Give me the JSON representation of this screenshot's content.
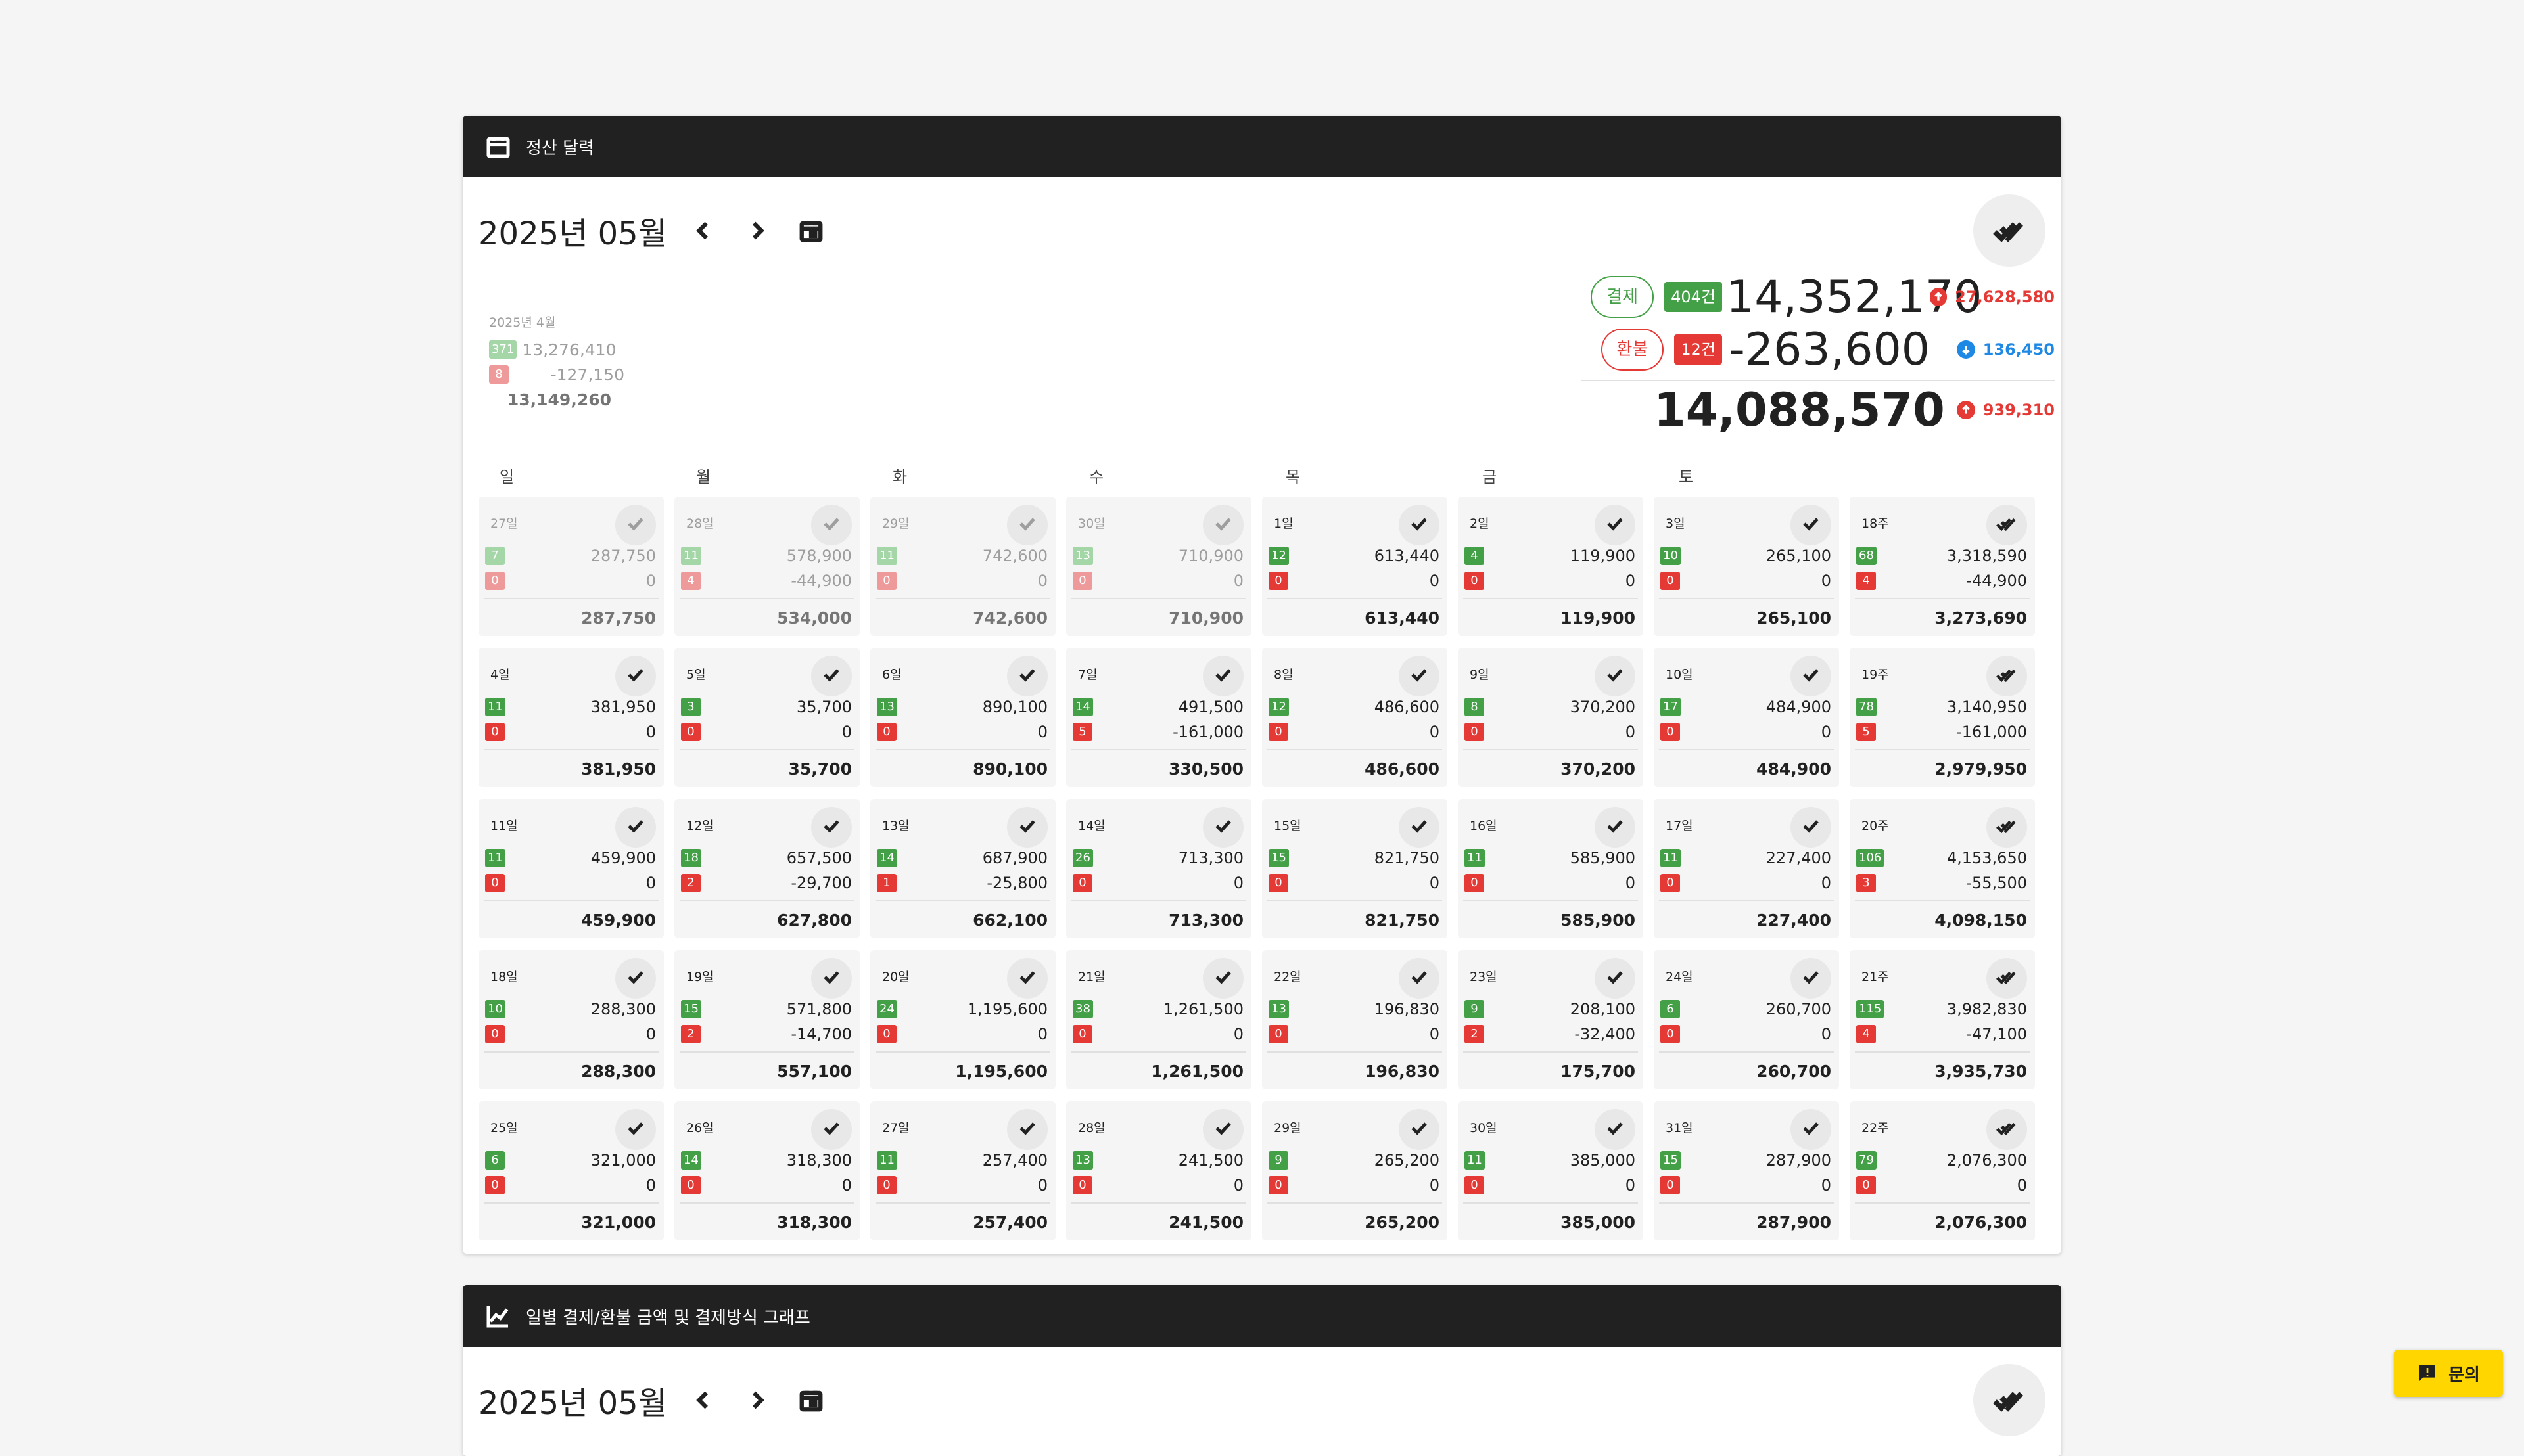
{
  "panel1": {
    "header_title": "정산 달력",
    "month_title": "2025년 05월",
    "prev_month": {
      "label": "2025년 4월",
      "pay_count": "371",
      "pay_amount": "13,276,410",
      "refund_count": "8",
      "refund_amount": "-127,150",
      "total": "13,149,260"
    },
    "summary": {
      "pay_label": "결제",
      "pay_count": "404건",
      "pay_amount": "14,352,170",
      "pay_delta": "27,628,580",
      "refund_label": "환불",
      "refund_count": "12건",
      "refund_amount": "-263,600",
      "refund_delta": "136,450",
      "total": "14,088,570",
      "total_delta": "939,310"
    },
    "weekdays": [
      "일",
      "월",
      "화",
      "수",
      "목",
      "금",
      "토"
    ],
    "cells": [
      {
        "label": "27일",
        "pc": "7",
        "pa": "287,750",
        "rc": "0",
        "ra": "0",
        "t": "287,750",
        "other": true
      },
      {
        "label": "28일",
        "pc": "11",
        "pa": "578,900",
        "rc": "4",
        "ra": "-44,900",
        "t": "534,000",
        "other": true
      },
      {
        "label": "29일",
        "pc": "11",
        "pa": "742,600",
        "rc": "0",
        "ra": "0",
        "t": "742,600",
        "other": true
      },
      {
        "label": "30일",
        "pc": "13",
        "pa": "710,900",
        "rc": "0",
        "ra": "0",
        "t": "710,900",
        "other": true
      },
      {
        "label": "1일",
        "pc": "12",
        "pa": "613,440",
        "rc": "0",
        "ra": "0",
        "t": "613,440"
      },
      {
        "label": "2일",
        "pc": "4",
        "pa": "119,900",
        "rc": "0",
        "ra": "0",
        "t": "119,900"
      },
      {
        "label": "3일",
        "pc": "10",
        "pa": "265,100",
        "rc": "0",
        "ra": "0",
        "t": "265,100"
      },
      {
        "label": "18주",
        "pc": "68",
        "pa": "3,318,590",
        "rc": "4",
        "ra": "-44,900",
        "t": "3,273,690",
        "week": true
      },
      {
        "label": "4일",
        "pc": "11",
        "pa": "381,950",
        "rc": "0",
        "ra": "0",
        "t": "381,950"
      },
      {
        "label": "5일",
        "pc": "3",
        "pa": "35,700",
        "rc": "0",
        "ra": "0",
        "t": "35,700"
      },
      {
        "label": "6일",
        "pc": "13",
        "pa": "890,100",
        "rc": "0",
        "ra": "0",
        "t": "890,100"
      },
      {
        "label": "7일",
        "pc": "14",
        "pa": "491,500",
        "rc": "5",
        "ra": "-161,000",
        "t": "330,500"
      },
      {
        "label": "8일",
        "pc": "12",
        "pa": "486,600",
        "rc": "0",
        "ra": "0",
        "t": "486,600"
      },
      {
        "label": "9일",
        "pc": "8",
        "pa": "370,200",
        "rc": "0",
        "ra": "0",
        "t": "370,200"
      },
      {
        "label": "10일",
        "pc": "17",
        "pa": "484,900",
        "rc": "0",
        "ra": "0",
        "t": "484,900"
      },
      {
        "label": "19주",
        "pc": "78",
        "pa": "3,140,950",
        "rc": "5",
        "ra": "-161,000",
        "t": "2,979,950",
        "week": true
      },
      {
        "label": "11일",
        "pc": "11",
        "pa": "459,900",
        "rc": "0",
        "ra": "0",
        "t": "459,900"
      },
      {
        "label": "12일",
        "pc": "18",
        "pa": "657,500",
        "rc": "2",
        "ra": "-29,700",
        "t": "627,800"
      },
      {
        "label": "13일",
        "pc": "14",
        "pa": "687,900",
        "rc": "1",
        "ra": "-25,800",
        "t": "662,100"
      },
      {
        "label": "14일",
        "pc": "26",
        "pa": "713,300",
        "rc": "0",
        "ra": "0",
        "t": "713,300"
      },
      {
        "label": "15일",
        "pc": "15",
        "pa": "821,750",
        "rc": "0",
        "ra": "0",
        "t": "821,750"
      },
      {
        "label": "16일",
        "pc": "11",
        "pa": "585,900",
        "rc": "0",
        "ra": "0",
        "t": "585,900"
      },
      {
        "label": "17일",
        "pc": "11",
        "pa": "227,400",
        "rc": "0",
        "ra": "0",
        "t": "227,400"
      },
      {
        "label": "20주",
        "pc": "106",
        "pa": "4,153,650",
        "rc": "3",
        "ra": "-55,500",
        "t": "4,098,150",
        "week": true
      },
      {
        "label": "18일",
        "pc": "10",
        "pa": "288,300",
        "rc": "0",
        "ra": "0",
        "t": "288,300"
      },
      {
        "label": "19일",
        "pc": "15",
        "pa": "571,800",
        "rc": "2",
        "ra": "-14,700",
        "t": "557,100"
      },
      {
        "label": "20일",
        "pc": "24",
        "pa": "1,195,600",
        "rc": "0",
        "ra": "0",
        "t": "1,195,600"
      },
      {
        "label": "21일",
        "pc": "38",
        "pa": "1,261,500",
        "rc": "0",
        "ra": "0",
        "t": "1,261,500"
      },
      {
        "label": "22일",
        "pc": "13",
        "pa": "196,830",
        "rc": "0",
        "ra": "0",
        "t": "196,830"
      },
      {
        "label": "23일",
        "pc": "9",
        "pa": "208,100",
        "rc": "2",
        "ra": "-32,400",
        "t": "175,700"
      },
      {
        "label": "24일",
        "pc": "6",
        "pa": "260,700",
        "rc": "0",
        "ra": "0",
        "t": "260,700"
      },
      {
        "label": "21주",
        "pc": "115",
        "pa": "3,982,830",
        "rc": "4",
        "ra": "-47,100",
        "t": "3,935,730",
        "week": true
      },
      {
        "label": "25일",
        "pc": "6",
        "pa": "321,000",
        "rc": "0",
        "ra": "0",
        "t": "321,000"
      },
      {
        "label": "26일",
        "pc": "14",
        "pa": "318,300",
        "rc": "0",
        "ra": "0",
        "t": "318,300"
      },
      {
        "label": "27일",
        "pc": "11",
        "pa": "257,400",
        "rc": "0",
        "ra": "0",
        "t": "257,400"
      },
      {
        "label": "28일",
        "pc": "13",
        "pa": "241,500",
        "rc": "0",
        "ra": "0",
        "t": "241,500"
      },
      {
        "label": "29일",
        "pc": "9",
        "pa": "265,200",
        "rc": "0",
        "ra": "0",
        "t": "265,200"
      },
      {
        "label": "30일",
        "pc": "11",
        "pa": "385,000",
        "rc": "0",
        "ra": "0",
        "t": "385,000"
      },
      {
        "label": "31일",
        "pc": "15",
        "pa": "287,900",
        "rc": "0",
        "ra": "0",
        "t": "287,900"
      },
      {
        "label": "22주",
        "pc": "79",
        "pa": "2,076,300",
        "rc": "0",
        "ra": "0",
        "t": "2,076,300",
        "week": true
      }
    ]
  },
  "panel2": {
    "header_title": "일별 결제/환불 금액 및 결제방식 그래프",
    "month_title": "2025년 05월"
  },
  "fab": {
    "label": "문의"
  },
  "colors": {
    "header_bg": "#212121",
    "pay_green": "#43a047",
    "refund_red": "#e53935",
    "delta_blue": "#1e88e5",
    "fab_yellow": "#ffd600"
  }
}
